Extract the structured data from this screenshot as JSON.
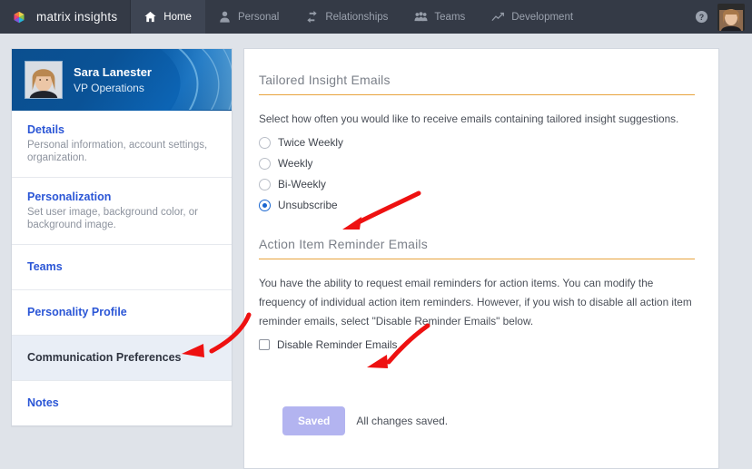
{
  "nav": {
    "brand": {
      "name": "matrix insights",
      "icon": "hexagon-logo-icon"
    },
    "items": [
      {
        "label": "Home",
        "icon": "home-icon",
        "active": true
      },
      {
        "label": "Personal",
        "icon": "person-icon",
        "active": false
      },
      {
        "label": "Relationships",
        "icon": "exchange-arrows-icon",
        "active": false
      },
      {
        "label": "Teams",
        "icon": "people-group-icon",
        "active": false
      },
      {
        "label": "Development",
        "icon": "trend-line-icon",
        "active": false
      }
    ],
    "help_icon": "help-circle-icon",
    "avatar_icon": "user-avatar"
  },
  "sidebar": {
    "profile": {
      "name": "Sara Lanester",
      "role": "VP Operations"
    },
    "items": [
      {
        "title": "Details",
        "desc": "Personal information, account settings, organization.",
        "active": false
      },
      {
        "title": "Personalization",
        "desc": "Set user image, background color, or background image.",
        "active": false
      },
      {
        "title": "Teams",
        "desc": "",
        "active": false
      },
      {
        "title": "Personality Profile",
        "desc": "",
        "active": false
      },
      {
        "title": "Communication Preferences",
        "desc": "",
        "active": true
      },
      {
        "title": "Notes",
        "desc": "",
        "active": false
      }
    ]
  },
  "main": {
    "section1": {
      "heading": "Tailored Insight Emails",
      "description": "Select how often you would like to receive emails containing tailored insight suggestions.",
      "options": [
        {
          "label": "Twice Weekly",
          "selected": false
        },
        {
          "label": "Weekly",
          "selected": false
        },
        {
          "label": "Bi-Weekly",
          "selected": false
        },
        {
          "label": "Unsubscribe",
          "selected": true
        }
      ]
    },
    "section2": {
      "heading": "Action Item Reminder Emails",
      "paragraph": "You have the ability to request email reminders for action items. You can modify the frequency of individual action item reminders. However, if you wish to disable all action item reminder emails, select \"Disable Reminder Emails\" below.",
      "checkbox": {
        "label": "Disable Reminder Emails",
        "checked": false
      }
    },
    "footer": {
      "save_label": "Saved",
      "status": "All changes saved."
    }
  },
  "annotations": {
    "color": "#ee1111",
    "arrows": [
      {
        "name": "arrow-to-unsubscribe"
      },
      {
        "name": "arrow-to-communication-preferences"
      },
      {
        "name": "arrow-to-disable-reminder-emails"
      }
    ]
  },
  "colors": {
    "nav_bg": "#343a46",
    "page_bg": "#dfe3e9",
    "accent_link": "#2b56d6",
    "accent_rule": "#e8a33d",
    "radio_selected": "#1a66d0",
    "saved_button": "#b3b4f0",
    "profile_blue": "#0a5296"
  }
}
